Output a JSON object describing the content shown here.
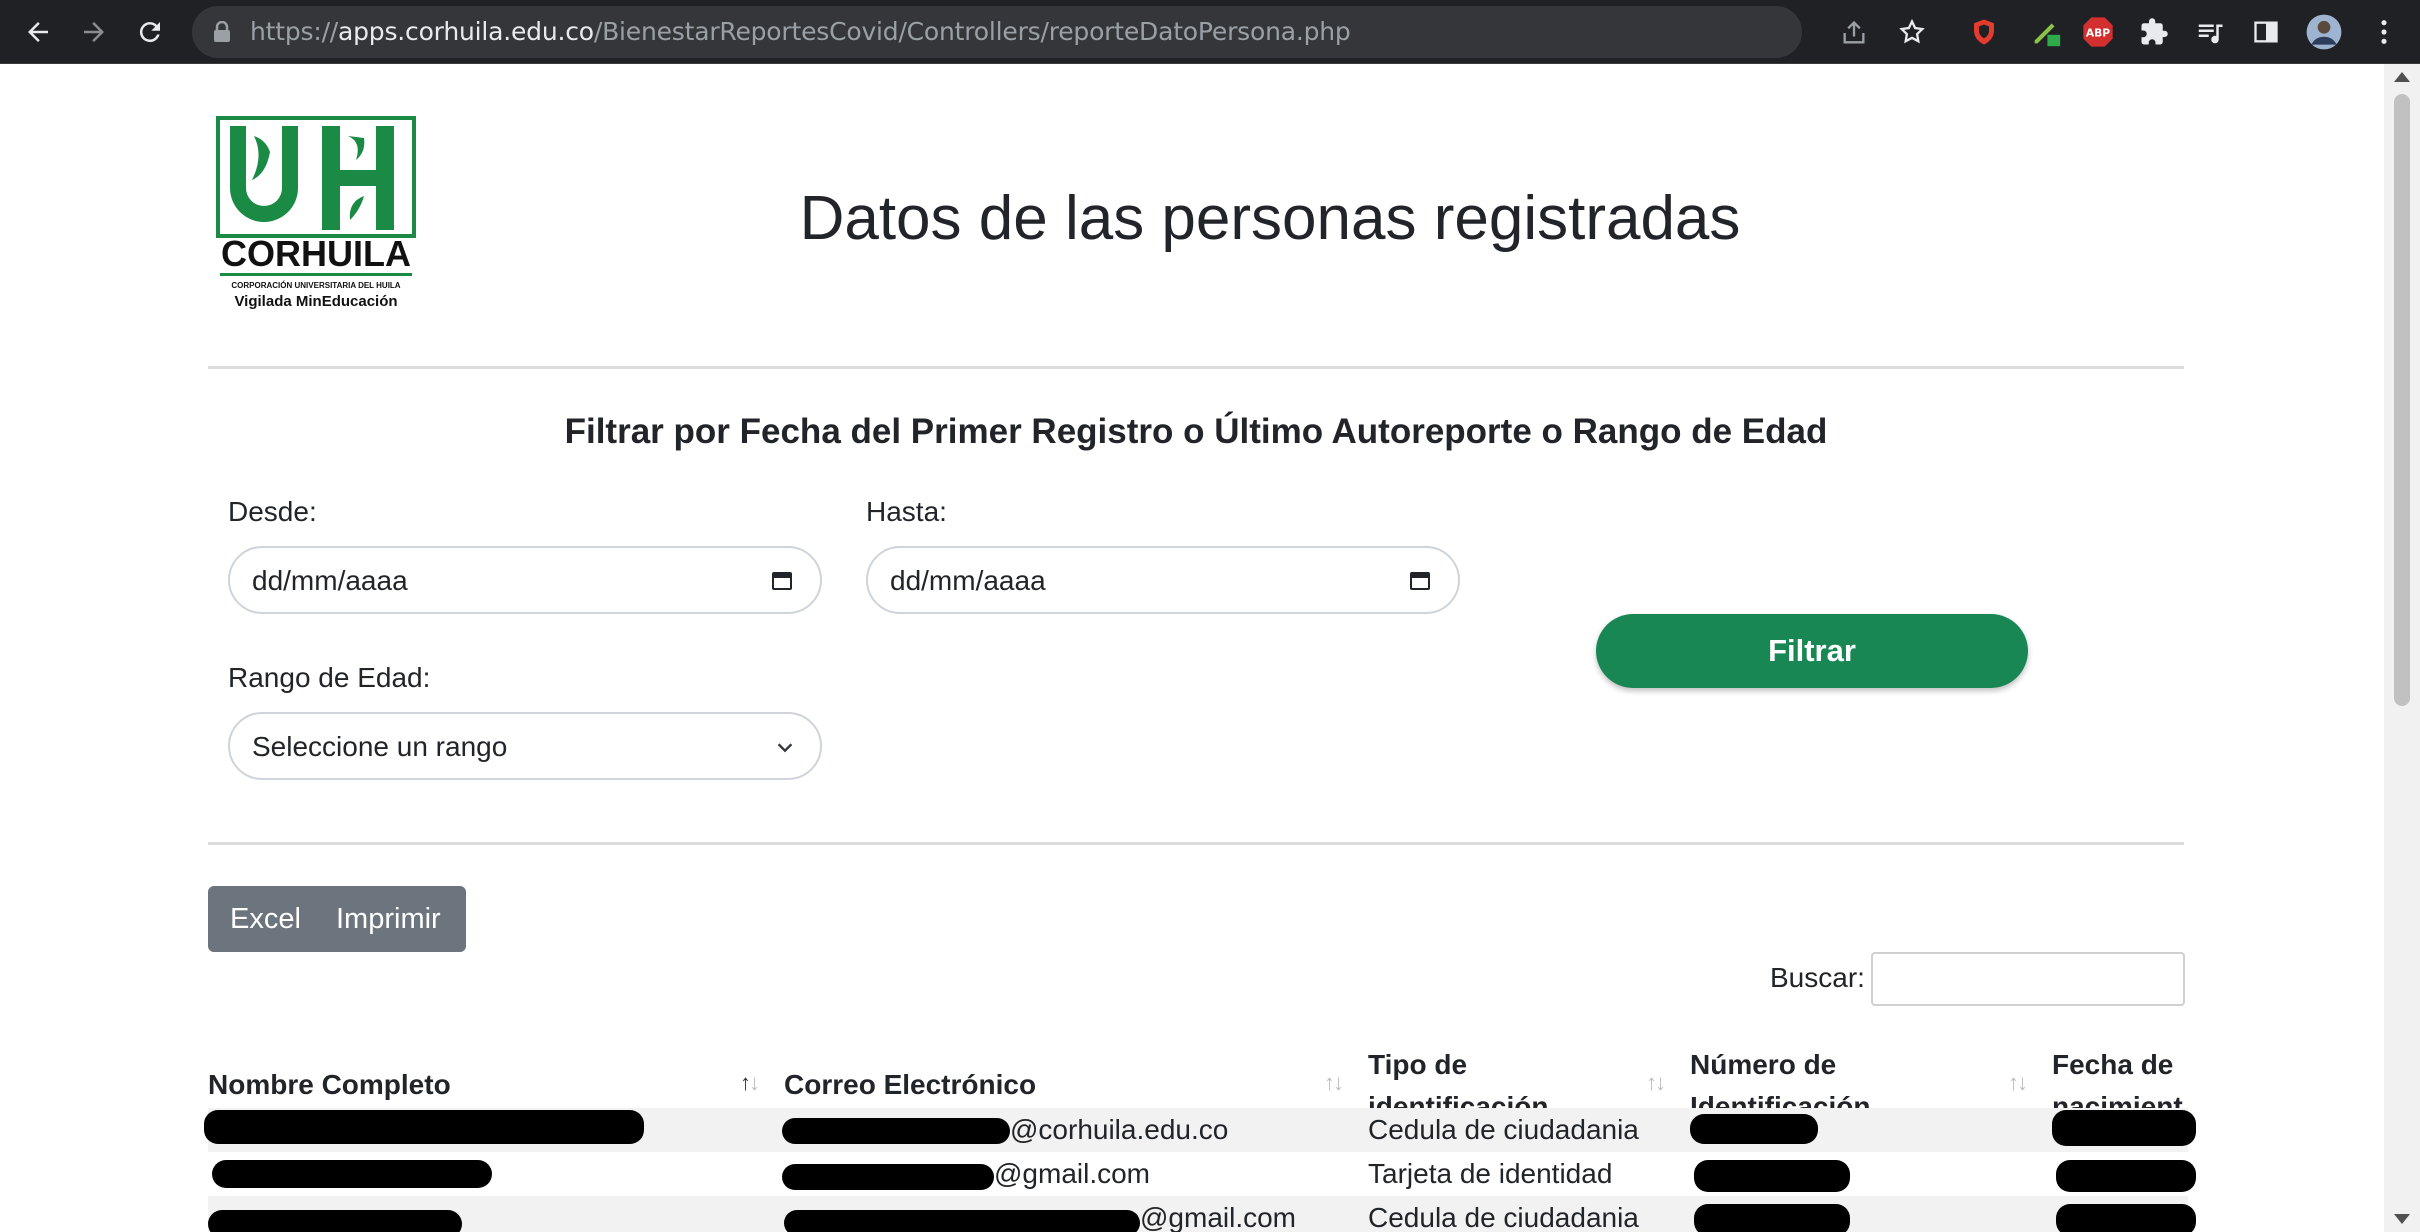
{
  "browser": {
    "url_prefix": "https://",
    "url_host": "apps.corhuila.edu.co",
    "url_path": "/BienestarReportesCovid/Controllers/reporteDatoPersona.php"
  },
  "logo": {
    "name": "CORHUILA",
    "subtitle": "CORPORACIÓN UNIVERSITARIA DEL HUILA",
    "tagline": "Vigilada MinEducación",
    "color": "#1a8a45"
  },
  "page": {
    "title": "Datos de las personas registradas"
  },
  "filter": {
    "title": "Filtrar por Fecha del Primer Registro o Último Autoreporte o Rango de Edad",
    "from_label": "Desde:",
    "from_placeholder": "dd/mm/aaaa",
    "to_label": "Hasta:",
    "to_placeholder": "dd/mm/aaaa",
    "age_label": "Rango de Edad:",
    "age_selected": "Seleccione un rango",
    "submit_label": "Filtrar"
  },
  "export": {
    "excel_label": "Excel",
    "print_label": "Imprimir"
  },
  "search": {
    "label": "Buscar:",
    "value": ""
  },
  "table": {
    "columns": [
      {
        "line1": "Nombre Completo",
        "line2": ""
      },
      {
        "line1": "Correo Electrónico",
        "line2": ""
      },
      {
        "line1": "Tipo de",
        "line2": "identificación"
      },
      {
        "line1": "Número de",
        "line2": "Identificación"
      },
      {
        "line1": "Fecha de",
        "line2": "nacimient"
      }
    ],
    "rows": [
      {
        "email_domain": "@corhuila.edu.co",
        "id_type": "Cedula de ciudadania"
      },
      {
        "email_domain": "@gmail.com",
        "id_type": "Tarjeta de identidad"
      },
      {
        "email_domain": "@gmail.com",
        "id_type": "Cedula de ciudadania"
      }
    ]
  },
  "colors": {
    "primary": "#198754",
    "secondary": "#6c757d",
    "chrome_bg": "#202124"
  }
}
